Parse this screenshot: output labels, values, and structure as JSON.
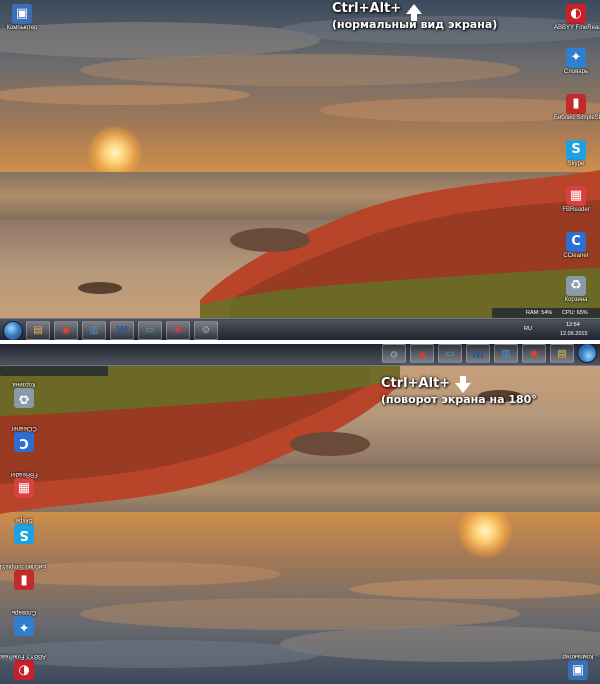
{
  "captions": {
    "top": {
      "title": "Ctrl+Alt+",
      "subtitle": "(нормальный вид экрана)"
    },
    "bottom": {
      "title": "Ctrl+Alt+",
      "subtitle": "(поворот экрана на 180°"
    }
  },
  "desktop_icons": {
    "left": [
      {
        "label": "Компьютер",
        "icon": "computer-icon",
        "color": "#3b6fb5",
        "glyph": "▣"
      }
    ],
    "right": [
      {
        "label": "ABBYY FineRead",
        "icon": "abbyy-icon",
        "color": "#c8202a",
        "glyph": "◐"
      },
      {
        "label": "Словарь",
        "icon": "dictionary-icon",
        "color": "#2f7fd0",
        "glyph": "✦"
      },
      {
        "label": "Библио SimpleSD",
        "icon": "book-icon",
        "color": "#c42a2a",
        "glyph": "▮"
      },
      {
        "label": "Skype",
        "icon": "skype-icon",
        "color": "#1aa3e0",
        "glyph": "S"
      },
      {
        "label": "FBReader",
        "icon": "fbreader-icon",
        "color": "#d94040",
        "glyph": "▦"
      },
      {
        "label": "CCleaner",
        "icon": "ccleaner-icon",
        "color": "#2c6fd0",
        "glyph": "C"
      },
      {
        "label": "Корзина",
        "icon": "recycle-bin-icon",
        "color": "#8a9aa8",
        "glyph": "♻"
      }
    ]
  },
  "taskbar": {
    "items": [
      {
        "icon": "folder-icon",
        "glyph": "▤",
        "color": "#e6b84c"
      },
      {
        "icon": "chrome-icon",
        "glyph": "◉",
        "color": "#d9463a"
      },
      {
        "icon": "explorer-icon",
        "glyph": "▥",
        "color": "#4a90c8"
      },
      {
        "icon": "word-icon",
        "glyph": "W",
        "color": "#2b5797"
      },
      {
        "icon": "monitor-icon",
        "glyph": "▭",
        "color": "#4aa0d8"
      },
      {
        "icon": "apps-icon",
        "glyph": "✱",
        "color": "#c84040"
      },
      {
        "icon": "settings-icon",
        "glyph": "⚙",
        "color": "#9aa8b4"
      }
    ],
    "tray": {
      "lang": "RU",
      "time": "12:54",
      "date": "12.06.2015"
    },
    "gadget": {
      "ram": "RAM: 54%",
      "cpu": "CPU: 65%"
    }
  },
  "colors": {
    "accent_sky": "#3b4a5c",
    "sun": "#ffd27a",
    "rocks": "#b8442a",
    "grass": "#5e7a2a"
  }
}
